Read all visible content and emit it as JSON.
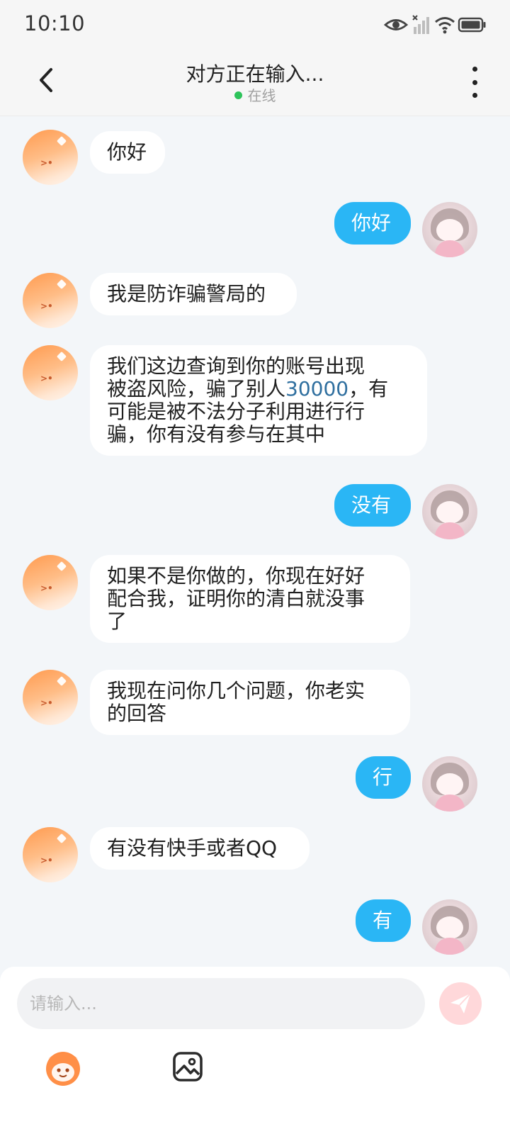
{
  "status_bar": {
    "time": "10:10"
  },
  "header": {
    "title": "对方正在输入...",
    "status": "在线"
  },
  "messages": [
    {
      "side": "received",
      "text": "你好"
    },
    {
      "side": "sent",
      "text": "你好"
    },
    {
      "side": "received",
      "text": "我是防诈骗警局的"
    },
    {
      "side": "received",
      "lines": [
        "我们这边查询到你的账号出现",
        "被盗风险，骗了别人",
        "30000",
        "，有",
        "可能是被不法分子利用进行行",
        "骗，你有没有参与在其中"
      ]
    },
    {
      "side": "sent",
      "text": "没有"
    },
    {
      "side": "received",
      "lines": [
        "如果不是你做的，你现在好好",
        "配合我，证明你的清白就没事",
        "了"
      ]
    },
    {
      "side": "received",
      "lines": [
        "我现在问你几个问题，你老实",
        "的回答"
      ]
    },
    {
      "side": "sent",
      "text": "行"
    },
    {
      "side": "received",
      "text": "有没有快手或者QQ"
    },
    {
      "side": "sent",
      "text": "有"
    }
  ],
  "input": {
    "placeholder": "请输入..."
  },
  "icons": {
    "back": "chevron-left-icon",
    "more": "more-vertical-icon",
    "send": "send-icon",
    "emoji": "emoji-face-icon",
    "image": "image-icon",
    "wifi": "wifi-icon",
    "eye": "eye-icon",
    "signal": "signal-icon",
    "battery": "battery-icon"
  },
  "colors": {
    "sent_bubble": "#2ab6f5",
    "received_bubble": "#ffffff",
    "online": "#2ec35b",
    "send_button_bg": "#ffd8da"
  }
}
